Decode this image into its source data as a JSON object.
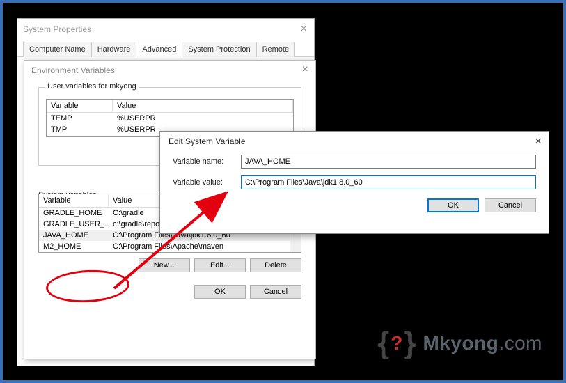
{
  "sysprop": {
    "title": "System Properties",
    "tabs": [
      "Computer Name",
      "Hardware",
      "Advanced",
      "System Protection",
      "Remote"
    ],
    "active_tab": 2
  },
  "envdlg": {
    "title": "Environment Variables",
    "uservars_label": "User variables for mkyong",
    "sysvars_label": "System variables",
    "col_variable": "Variable",
    "col_value": "Value",
    "user_rows": [
      {
        "var": "TEMP",
        "val": "%USERPR"
      },
      {
        "var": "TMP",
        "val": "%USERPR"
      }
    ],
    "sys_rows": [
      {
        "var": "GRADLE_HOME",
        "val": "C:\\gradle"
      },
      {
        "var": "GRADLE_USER_...",
        "val": "c:\\gradle\\repo"
      },
      {
        "var": "JAVA_HOME",
        "val": "C:\\Program Files\\Java\\jdk1.8.0_60"
      },
      {
        "var": "M2_HOME",
        "val": "C:\\Program Files\\Apache\\maven"
      }
    ],
    "btn_new": "New...",
    "btn_edit": "Edit...",
    "btn_delete": "Delete",
    "btn_ok": "OK",
    "btn_cancel": "Cancel"
  },
  "editdlg": {
    "title": "Edit System Variable",
    "label_name": "Variable name:",
    "label_value": "Variable value:",
    "name_value": "JAVA_HOME",
    "value_value": "C:\\Program Files\\Java\\jdk1.8.0_60",
    "btn_ok": "OK",
    "btn_cancel": "Cancel"
  },
  "logo": {
    "brand": "Mkyong",
    "tld": ".com"
  },
  "colors": {
    "frame_border": "#3a70b8",
    "annotation_red": "#e3000f",
    "windows_accent": "#0078d7",
    "logo_accent": "#c9302c"
  }
}
